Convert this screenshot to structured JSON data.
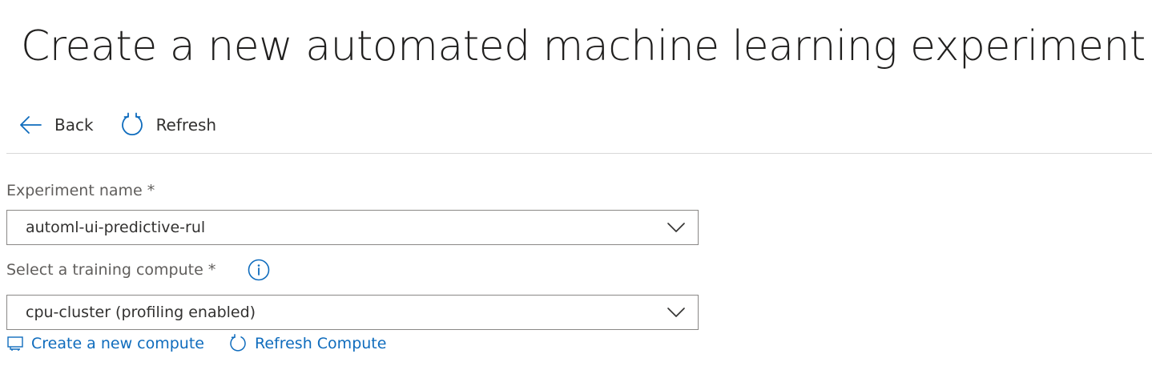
{
  "page": {
    "title": "Create a new automated machine learning experiment"
  },
  "toolbar": {
    "back_label": "Back",
    "back_icon": "arrow-left-icon",
    "refresh_label": "Refresh",
    "refresh_icon": "refresh-icon"
  },
  "form": {
    "experiment_name": {
      "label": "Experiment name *",
      "value": "automl-ui-predictive-rul"
    },
    "training_compute": {
      "label": "Select a training compute *",
      "value": "cpu-cluster (profiling enabled)",
      "info_icon": "info-icon"
    }
  },
  "links": {
    "create_compute_label": "Create a new compute",
    "create_compute_icon": "compute-icon",
    "refresh_compute_label": "Refresh Compute",
    "refresh_compute_icon": "refresh-icon"
  },
  "colors": {
    "accent": "#0f6cbd",
    "text": "#323130",
    "label": "#605e5c",
    "border": "#8a8886",
    "divider": "#d8d8d8"
  }
}
